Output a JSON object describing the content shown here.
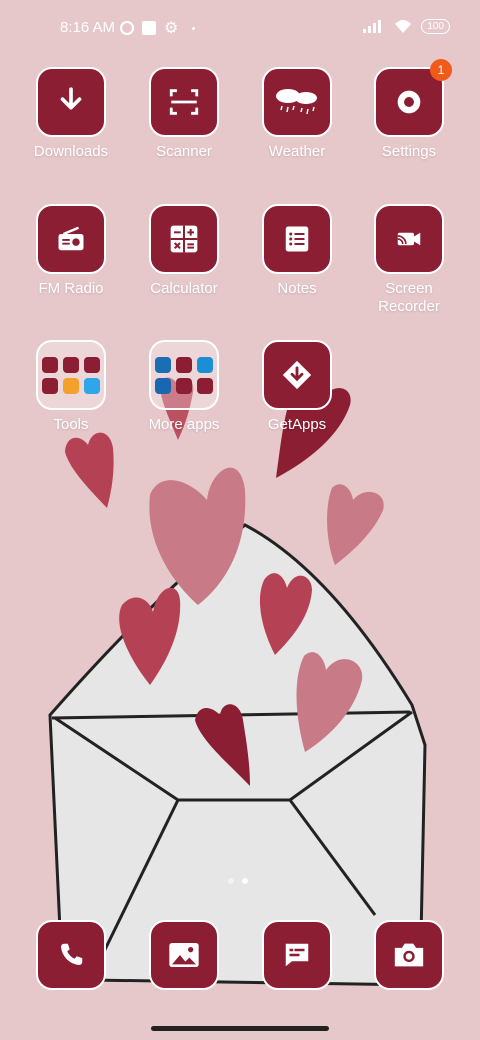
{
  "status_bar": {
    "time": "8:16 AM",
    "battery": "100"
  },
  "apps": [
    {
      "label": "Downloads",
      "icon": "download-icon"
    },
    {
      "label": "Scanner",
      "icon": "scanner-icon"
    },
    {
      "label": "Weather",
      "icon": "weather-icon"
    },
    {
      "label": "Settings",
      "icon": "gear-icon",
      "badge": "1"
    },
    {
      "label": "FM Radio",
      "icon": "radio-icon"
    },
    {
      "label": "Calculator",
      "icon": "calculator-icon"
    },
    {
      "label": "Notes",
      "icon": "notes-icon"
    },
    {
      "label": "Screen Recorder",
      "icon": "screen-recorder-icon"
    },
    {
      "label": "Tools",
      "icon": "folder-icon"
    },
    {
      "label": "More apps",
      "icon": "folder-icon"
    },
    {
      "label": "GetApps",
      "icon": "getapps-icon"
    }
  ],
  "dock": [
    {
      "icon": "phone-icon"
    },
    {
      "icon": "gallery-icon"
    },
    {
      "icon": "messages-icon"
    },
    {
      "icon": "camera-icon"
    }
  ],
  "page_indicator": {
    "count": 2,
    "active": 2
  },
  "colors": {
    "accent": "#8b1e33",
    "background": "#e6c8cb",
    "badge": "#f05a1a"
  }
}
